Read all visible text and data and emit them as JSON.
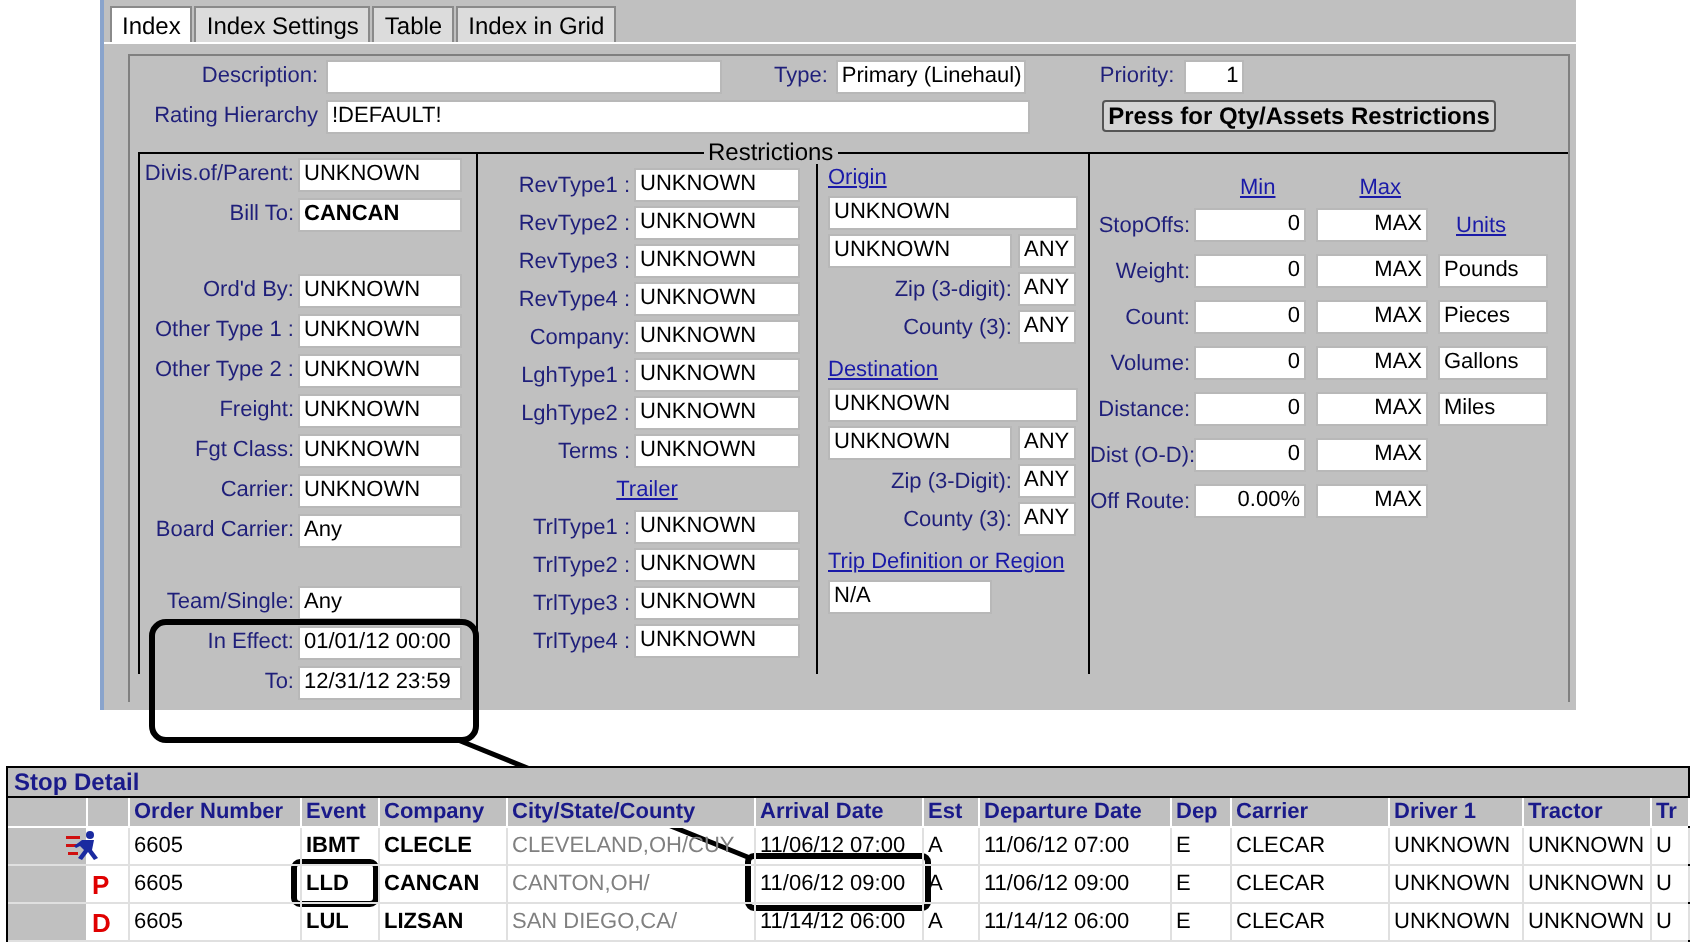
{
  "tabs": [
    {
      "label": "Index",
      "selected": true
    },
    {
      "label": "Index Settings",
      "selected": false
    },
    {
      "label": "Table",
      "selected": false
    },
    {
      "label": "Index in Grid",
      "selected": false
    }
  ],
  "description": {
    "label": "Description:"
  },
  "type": {
    "label": "Type:",
    "value": "Primary (Linehaul)"
  },
  "priority": {
    "label": "Priority:",
    "value": "1"
  },
  "rating_hierarchy": {
    "label": "Rating Hierarchy",
    "value": "!DEFAULT!"
  },
  "restrictions_button": "Press for Qty/Assets Restrictions",
  "restrictions": {
    "title": "Restrictions",
    "general": [
      {
        "label": "Divis.of/Parent:",
        "value": "UNKNOWN",
        "bold": false
      },
      {
        "label": "Bill To:",
        "value": "CANCAN",
        "bold": true
      },
      {
        "label": "Ord'd By:",
        "value": "UNKNOWN",
        "bold": false
      },
      {
        "label": "Other Type 1 :",
        "value": "UNKNOWN",
        "bold": false
      },
      {
        "label": "Other Type 2 :",
        "value": "UNKNOWN",
        "bold": false
      },
      {
        "label": "Freight:",
        "value": "UNKNOWN",
        "bold": false
      },
      {
        "label": "Fgt Class:",
        "value": "UNKNOWN",
        "bold": false
      },
      {
        "label": "Carrier:",
        "value": "UNKNOWN",
        "bold": false
      },
      {
        "label": "Board Carrier:",
        "value": "Any",
        "bold": false
      },
      {
        "label": "Team/Single:",
        "value": "Any",
        "bold": false
      },
      {
        "label": "In Effect:",
        "value": "01/01/12 00:00",
        "bold": false
      },
      {
        "label": "To:",
        "value": "12/31/12 23:59",
        "bold": false
      }
    ],
    "types": [
      {
        "kind": "field",
        "label": "RevType1 :",
        "value": "UNKNOWN"
      },
      {
        "kind": "field",
        "label": "RevType2 :",
        "value": "UNKNOWN"
      },
      {
        "kind": "field",
        "label": "RevType3 :",
        "value": "UNKNOWN"
      },
      {
        "kind": "field",
        "label": "RevType4 :",
        "value": "UNKNOWN"
      },
      {
        "kind": "field",
        "label": "Company:",
        "value": "UNKNOWN"
      },
      {
        "kind": "field",
        "label": "LghType1 :",
        "value": "UNKNOWN"
      },
      {
        "kind": "field",
        "label": "LghType2 :",
        "value": "UNKNOWN"
      },
      {
        "kind": "field",
        "label": "Terms :",
        "value": "UNKNOWN"
      },
      {
        "kind": "heading",
        "text": "Trailer"
      },
      {
        "kind": "field",
        "label": "TrlType1 :",
        "value": "UNKNOWN"
      },
      {
        "kind": "field",
        "label": "TrlType2 :",
        "value": "UNKNOWN"
      },
      {
        "kind": "field",
        "label": "TrlType3 :",
        "value": "UNKNOWN"
      },
      {
        "kind": "field",
        "label": "TrlType4 :",
        "value": "UNKNOWN"
      }
    ],
    "locations": [
      {
        "kind": "heading",
        "text": "Origin"
      },
      {
        "kind": "wide",
        "value": "UNKNOWN"
      },
      {
        "kind": "pair",
        "value": "UNKNOWN",
        "extra": "ANY"
      },
      {
        "kind": "labeled",
        "label": "Zip (3-digit):",
        "value": "ANY"
      },
      {
        "kind": "labeled",
        "label": "County (3):",
        "value": "ANY"
      },
      {
        "kind": "heading",
        "text": "Destination"
      },
      {
        "kind": "wide",
        "value": "UNKNOWN"
      },
      {
        "kind": "pair",
        "value": "UNKNOWN",
        "extra": "ANY"
      },
      {
        "kind": "labeled",
        "label": "Zip (3-Digit):",
        "value": "ANY"
      },
      {
        "kind": "labeled",
        "label": "County (3):",
        "value": "ANY"
      },
      {
        "kind": "heading",
        "text": "Trip Definition or Region"
      },
      {
        "kind": "medium",
        "value": "N/A"
      }
    ],
    "quantities": {
      "min_heading": "Min",
      "max_heading": "Max",
      "rows": [
        {
          "label": "StopOffs:",
          "min": "0",
          "max": "MAX",
          "units_heading": "Units"
        },
        {
          "label": "Weight:",
          "min": "0",
          "max": "MAX",
          "units": "Pounds"
        },
        {
          "label": "Count:",
          "min": "0",
          "max": "MAX",
          "units": "Pieces"
        },
        {
          "label": "Volume:",
          "min": "0",
          "max": "MAX",
          "units": "Gallons"
        },
        {
          "label": "Distance:",
          "min": "0",
          "max": "MAX",
          "units": "Miles"
        },
        {
          "label": "Dist (O-D):",
          "min": "0",
          "max": "MAX"
        },
        {
          "label": "Off Route:",
          "min": "0.00%",
          "max": "MAX"
        }
      ]
    }
  },
  "stop_detail": {
    "title": "Stop Detail",
    "columns": [
      "Order Number",
      "Event",
      "Company",
      "City/State/County",
      "Arrival Date",
      "Est",
      "Departure Date",
      "Dep",
      "Carrier",
      "Driver 1",
      "Tractor",
      "Tr"
    ],
    "rows": [
      {
        "kind": "current",
        "cells": [
          "6605",
          "IBMT",
          "CLECLE",
          "CLEVELAND,OH/CUY",
          "11/06/12 07:00",
          "A",
          "11/06/12 07:00",
          "E",
          "CLECAR",
          "UNKNOWN",
          "UNKNOWN",
          "U"
        ]
      },
      {
        "kind": "stop",
        "marker": "P",
        "cells": [
          "6605",
          "LLD",
          "CANCAN",
          "CANTON,OH/",
          "11/06/12 09:00",
          "A",
          "11/06/12 09:00",
          "E",
          "CLECAR",
          "UNKNOWN",
          "UNKNOWN",
          "U"
        ]
      },
      {
        "kind": "stop",
        "marker": "D",
        "cells": [
          "6605",
          "LUL",
          "LIZSAN",
          "SAN DIEGO,CA/",
          "11/14/12 06:00",
          "A",
          "11/14/12 06:00",
          "E",
          "CLECAR",
          "UNKNOWN",
          "UNKNOWN",
          "U"
        ]
      }
    ]
  }
}
